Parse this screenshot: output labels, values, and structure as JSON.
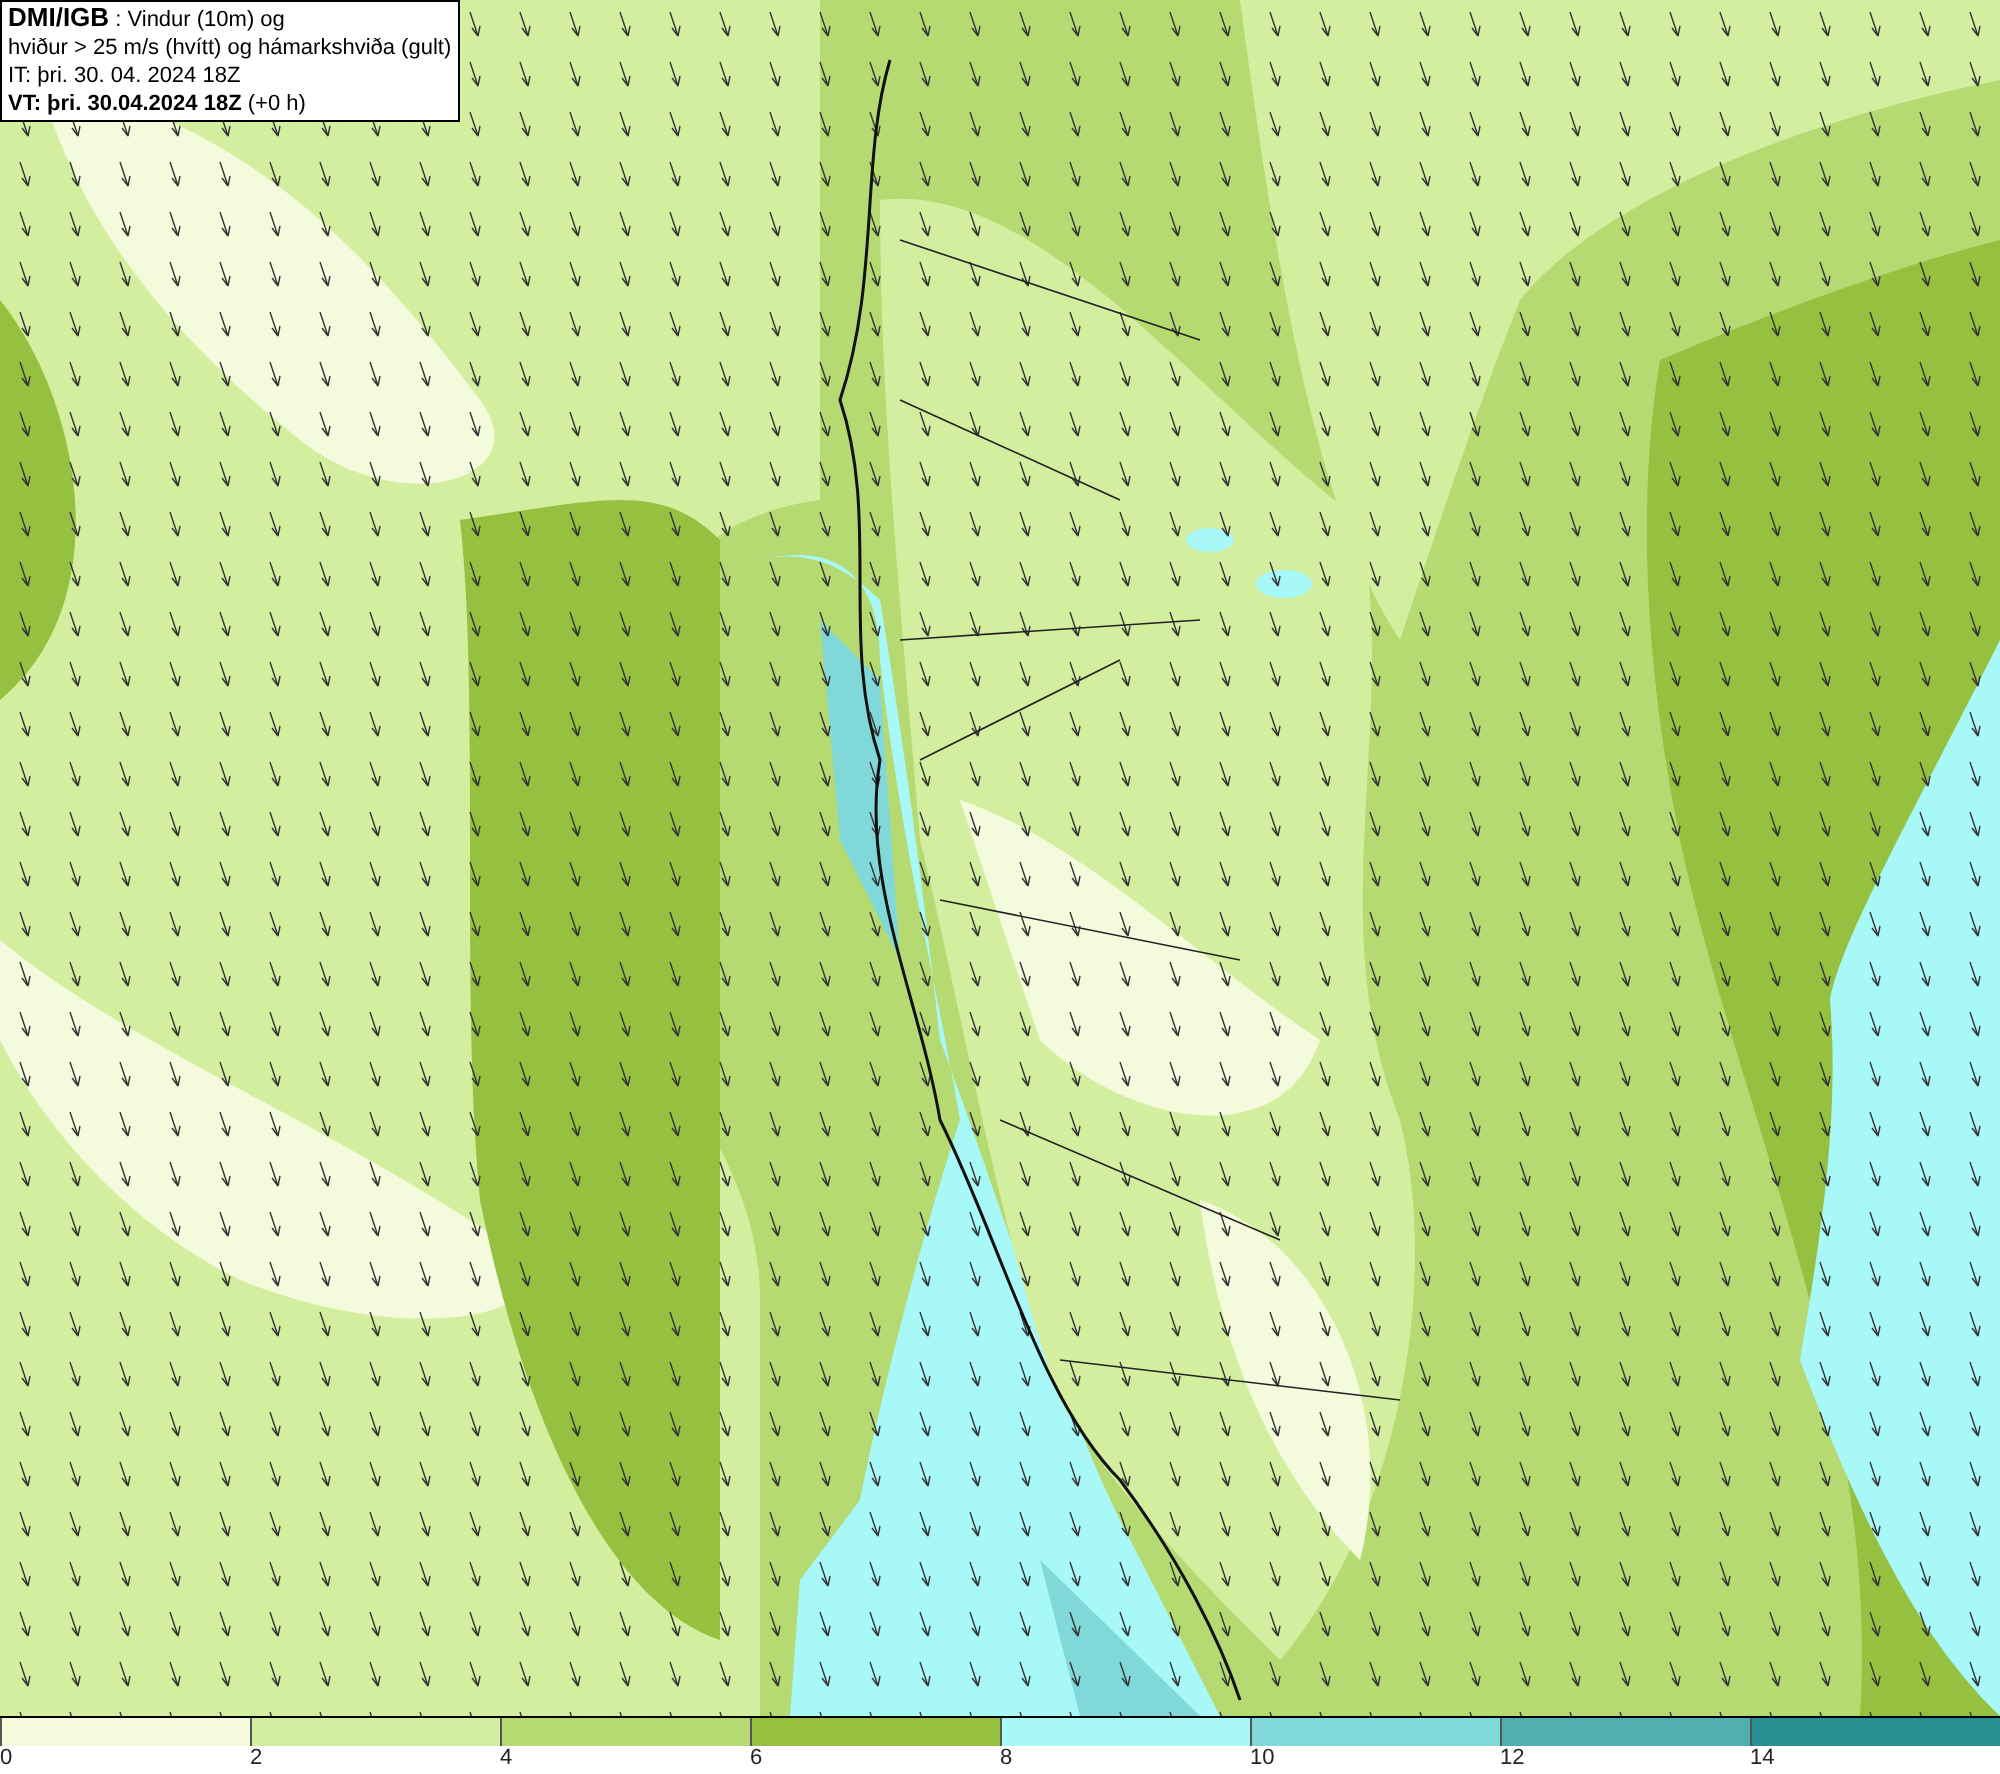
{
  "title_box": {
    "lines": [
      "**DMI/IGB** : Vindur (10m) og",
      "hviður > 25 m/s (hvítt) og hámarkshviða (gult)",
      "IT: þri. 30. 04. 2024 18Z",
      "**VT: þri. 30.04.2024 18Z** (+0 h)"
    ]
  },
  "legend": {
    "bins": [
      {
        "color": "#f4fbdc"
      },
      {
        "color": "#d4eea0"
      },
      {
        "color": "#b6da72"
      },
      {
        "color": "#96c040"
      },
      {
        "color": "#a8f8f8"
      },
      {
        "color": "#80d8d8"
      },
      {
        "color": "#50b0b0"
      },
      {
        "color": "#289090"
      }
    ],
    "ticks": [
      "0",
      "2",
      "4",
      "6",
      "8",
      "10",
      "12",
      "14"
    ]
  }
}
